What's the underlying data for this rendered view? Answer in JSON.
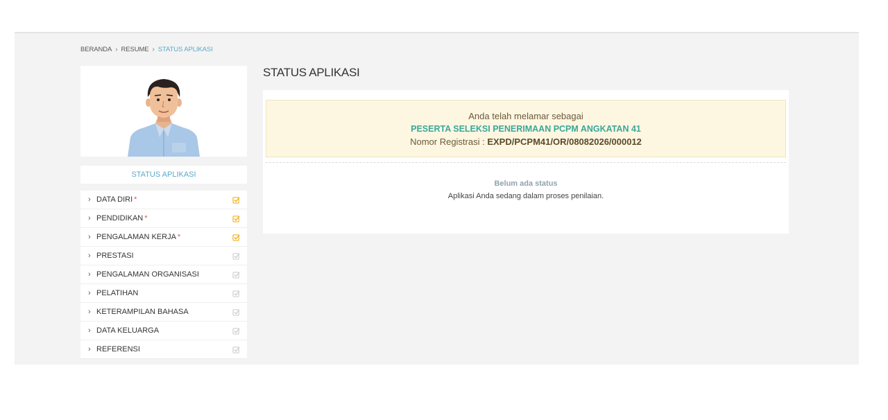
{
  "breadcrumb": {
    "home": "BERANDA",
    "resume": "RESUME",
    "current": "STATUS APLIKASI"
  },
  "sidebar": {
    "status_label": "STATUS APLIKASI",
    "items": [
      {
        "label": "DATA DIRI",
        "required": "*",
        "completed": true
      },
      {
        "label": "PENDIDIKAN",
        "required": "*",
        "completed": true
      },
      {
        "label": "PENGALAMAN KERJA",
        "required": "*",
        "completed": true
      },
      {
        "label": "PRESTASI",
        "required": "",
        "completed": false
      },
      {
        "label": "PENGALAMAN ORGANISASI",
        "required": "",
        "completed": false
      },
      {
        "label": "PELATIHAN",
        "required": "",
        "completed": false
      },
      {
        "label": "KETERAMPILAN BAHASA",
        "required": "",
        "completed": false
      },
      {
        "label": "DATA KELUARGA",
        "required": "",
        "completed": false
      },
      {
        "label": "REFERENSI",
        "required": "",
        "completed": false
      }
    ]
  },
  "main": {
    "title": "STATUS APLIKASI",
    "notice": {
      "line1": "Anda telah melamar sebagai",
      "position": "PESERTA SELEKSI PENERIMAAN PCPM ANGKATAN 41",
      "reg_label": "Nomor Registrasi : ",
      "reg_number": "EXPD/PCPM41/OR/08082026/000012"
    },
    "status_title": "Belum ada status",
    "status_desc": "Aplikasi Anda sedang dalam proses penilaian."
  },
  "colors": {
    "accent": "#5aa8c8",
    "check_done": "#f0b429",
    "check_pending": "#d0d0d0",
    "notice_bg": "#fdf6e1",
    "position_text": "#3aa79a"
  }
}
